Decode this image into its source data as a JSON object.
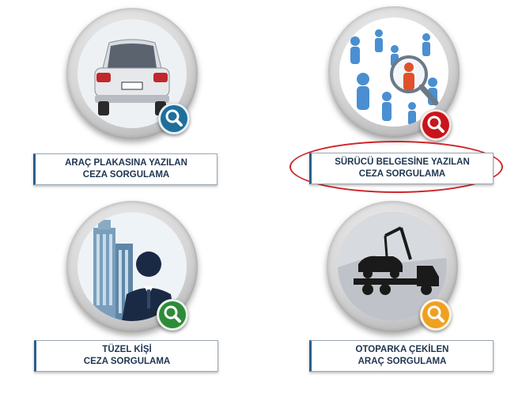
{
  "tiles": [
    {
      "line1": "ARAÇ PLAKASINA YAZILAN",
      "line2": "CEZA SORGULAMA",
      "icon": "search-icon",
      "badge_color": "#1f6f9c"
    },
    {
      "line1": "SÜRÜCÜ BELGESİNE YAZILAN",
      "line2": "CEZA SORGULAMA",
      "icon": "search-icon",
      "badge_color": "#c8141a"
    },
    {
      "line1": "TÜZEL KİŞİ",
      "line2": "CEZA SORGULAMA",
      "icon": "search-icon",
      "badge_color": "#2e8b3a"
    },
    {
      "line1": "OTOPARKA ÇEKİLEN",
      "line2": "ARAÇ SORGULAMA",
      "icon": "search-icon",
      "badge_color": "#f0a020"
    }
  ],
  "colors": {
    "label_text": "#1e3550",
    "label_border": "#2d5f8f",
    "highlight": "#d0262a"
  }
}
